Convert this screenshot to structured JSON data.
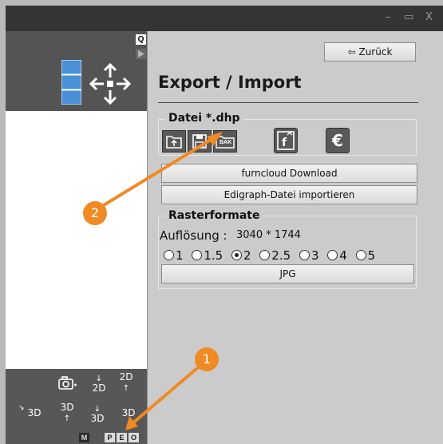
{
  "window": {
    "controls": {
      "minimize": "–",
      "maximize": "▭",
      "close": "X"
    }
  },
  "left": {
    "search_icon": "Q",
    "bottom_buttons": {
      "row1": [
        "📷",
        "2D",
        "2D"
      ],
      "row2": [
        "3D",
        "3D",
        "3D",
        "3D"
      ]
    },
    "mode_buttons": [
      "M",
      "P",
      "E",
      "O"
    ]
  },
  "right": {
    "back_button": "⇦ Zurück",
    "title": "Export / Import",
    "datei": {
      "title": "Datei *.dhp",
      "bak_label": "BAK",
      "euro_label": "€"
    },
    "furncloud_button": "furncloud Download",
    "edigraph_button": "Edigraph-Datei importieren",
    "raster": {
      "title": "Rasterformate",
      "resolution_label": "Auflösung :",
      "resolution_value": "3040 * 1744",
      "options": [
        "1",
        "1.5",
        "2",
        "2.5",
        "3",
        "4",
        "5"
      ],
      "selected": "2",
      "jpg_button": "JPG"
    }
  },
  "annotations": {
    "badge1": "1",
    "badge2": "2"
  },
  "colors": {
    "accent": "#f08a24",
    "view_blue": "#4a90d9"
  }
}
